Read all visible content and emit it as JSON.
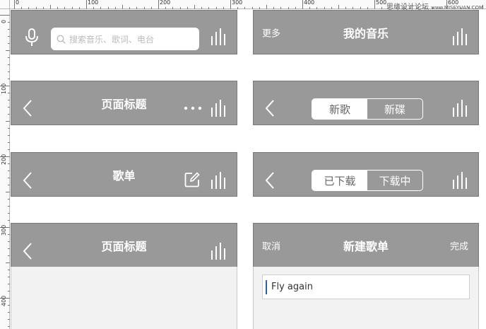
{
  "watermark": {
    "text": "思缘设计论坛",
    "site": "www.MISSYUAN.COM"
  },
  "ruler": {
    "h_labels": [
      "0",
      "100",
      "200",
      "300",
      "400",
      "500",
      "600"
    ],
    "v_labels": [
      "0",
      "100",
      "200",
      "300",
      "400"
    ]
  },
  "bars": {
    "search_bar": {
      "placeholder": "搜索音乐、歌词、电台",
      "icons": [
        "microphone-icon",
        "search-icon",
        "equalizer-icon"
      ]
    },
    "my_music": {
      "left_text": "更多",
      "title": "我的音乐"
    },
    "page_title_more": {
      "title": "页面标题"
    },
    "seg_new": {
      "tabs": [
        "新歌",
        "新碟"
      ],
      "active": 0
    },
    "playlist": {
      "title": "歌单"
    },
    "seg_download": {
      "tabs": [
        "已下载",
        "下载中"
      ],
      "active": 0
    },
    "page_title": {
      "title": "页面标题"
    },
    "new_playlist": {
      "cancel": "取消",
      "title": "新建歌单",
      "done": "完成",
      "input_value": "Fly again"
    }
  },
  "colors": {
    "bar": "#999999",
    "content": "#f2f2f2",
    "caret": "#2f5fb0"
  }
}
